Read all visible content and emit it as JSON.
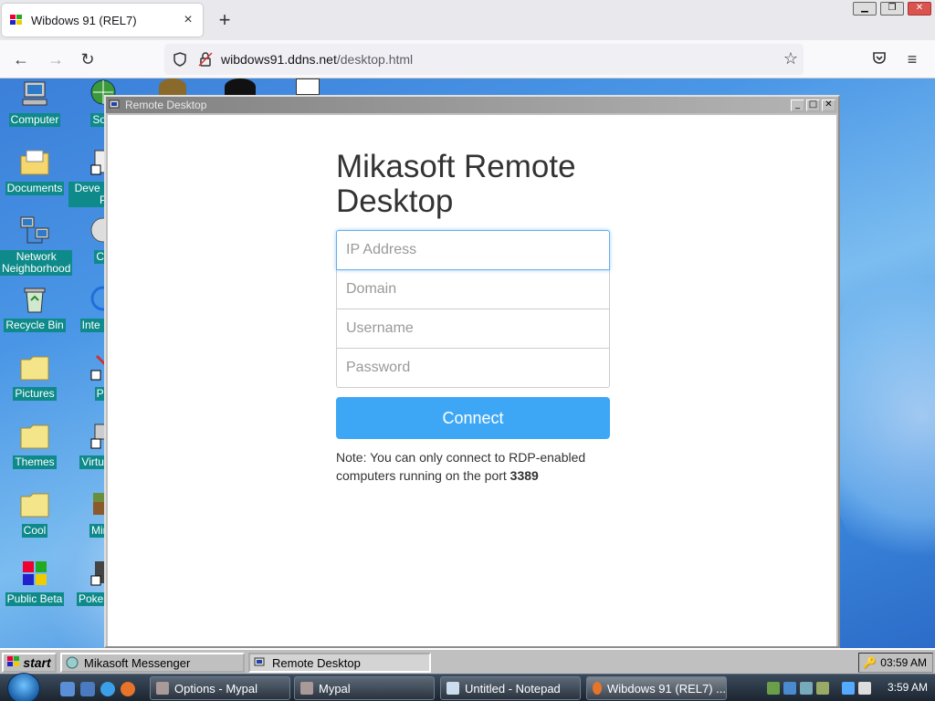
{
  "browser": {
    "tab_title": "Wibdows 91 (REL7)",
    "tab_close": "×",
    "new_tab": "+",
    "url_host": "wibdows91.ddns.net",
    "url_path": "/desktop.html"
  },
  "desktop": {
    "icons": [
      {
        "label": "Computer"
      },
      {
        "label": "Soci"
      },
      {
        "label": "Documents"
      },
      {
        "label": "Deve Install P"
      },
      {
        "label": "Network Neighborhood"
      },
      {
        "label": "Ch"
      },
      {
        "label": "Recycle Bin"
      },
      {
        "label": "Inte Expl"
      },
      {
        "label": "Pictures"
      },
      {
        "label": "Pa"
      },
      {
        "label": "Themes"
      },
      {
        "label": "Virtual M"
      },
      {
        "label": "Cool"
      },
      {
        "label": "Mine"
      },
      {
        "label": "Public Beta"
      },
      {
        "label": "Poke Plati"
      }
    ]
  },
  "remote_window": {
    "title": "Remote Desktop",
    "heading": "Mikasoft Remote Desktop",
    "fields": {
      "ip_placeholder": "IP Address",
      "domain_placeholder": "Domain",
      "username_placeholder": "Username",
      "password_placeholder": "Password"
    },
    "connect_label": "Connect",
    "note_text": "Note: You can only connect to RDP-enabled computers running on the port ",
    "note_port": "3389"
  },
  "taskbar98": {
    "start_label": "start",
    "items": [
      {
        "label": "Mikasoft Messenger"
      },
      {
        "label": "Remote Desktop"
      }
    ],
    "clock": "03:59 AM"
  },
  "taskbar7": {
    "items": [
      {
        "label": "Options - Mypal"
      },
      {
        "label": "Mypal"
      },
      {
        "label": "Untitled - Notepad"
      },
      {
        "label": "Wibdows 91 (REL7) ..."
      }
    ],
    "clock": "3:59 AM"
  },
  "colors": {
    "accent_button": "#3ea7f5",
    "desktop_label_bg": "#0e8a8a",
    "win95_face": "#c0c0c0"
  }
}
